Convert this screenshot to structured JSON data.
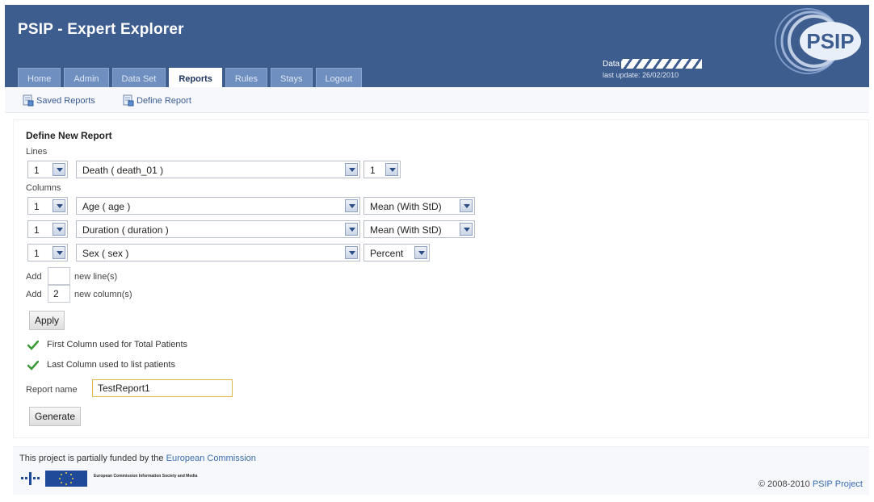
{
  "header": {
    "app_title": "PSIP - Expert Explorer",
    "data_label": "Data",
    "last_update": "last update: 26/02/2010",
    "logo_text": "PSIP"
  },
  "tabs": [
    {
      "label": "Home"
    },
    {
      "label": "Admin"
    },
    {
      "label": "Data Set"
    },
    {
      "label": "Reports",
      "active": true
    },
    {
      "label": "Rules"
    },
    {
      "label": "Stays"
    },
    {
      "label": "Logout"
    }
  ],
  "subnav": {
    "saved_reports": "Saved Reports",
    "define_report": "Define Report"
  },
  "report": {
    "title": "Define New Report",
    "lines_label": "Lines",
    "columns_label": "Columns",
    "lines": [
      {
        "order": "1",
        "variable": "Death ( death_01 )",
        "stat": "1"
      }
    ],
    "columns": [
      {
        "order": "1",
        "variable": "Age ( age )",
        "stat": "Mean (With StD)"
      },
      {
        "order": "1",
        "variable": "Duration ( duration )",
        "stat": "Mean (With StD)"
      },
      {
        "order": "1",
        "variable": "Sex ( sex )",
        "stat": "Percent"
      }
    ],
    "add_label": "Add",
    "add_lines_value": "",
    "add_lines_suffix": "new line(s)",
    "add_columns_value": "2",
    "add_columns_suffix": "new column(s)",
    "apply_button": "Apply",
    "note_first_column": "First Column used for Total Patients",
    "note_last_column": "Last Column used to list patients",
    "report_name_label": "Report name",
    "report_name_value": "TestReport1",
    "generate_button": "Generate"
  },
  "footer": {
    "funded_text": "This project is partially funded by the",
    "funded_link": "European Commission",
    "eu_logo_text": "European Commission Information Society and Media",
    "copyright_text": "© 2008-2010",
    "copyright_link": "PSIP Project"
  },
  "colors": {
    "header_bg": "#3e5d8f",
    "tab_bg": "#6f8fc0",
    "link": "#3a6db0",
    "check": "#3d9a3a"
  }
}
